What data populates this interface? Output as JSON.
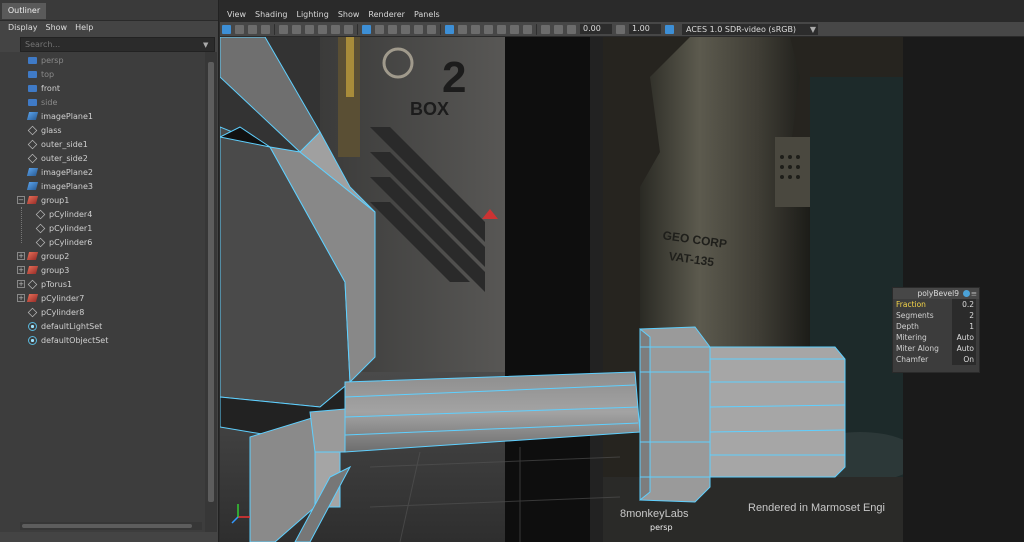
{
  "outliner": {
    "tab": "Outliner",
    "menu": [
      "Display",
      "Show",
      "Help"
    ],
    "search_placeholder": "Search...",
    "items": [
      {
        "label": "persp",
        "icon": "camera-icon",
        "indent": 1,
        "dim": true
      },
      {
        "label": "top",
        "icon": "camera-icon",
        "indent": 1,
        "dim": true
      },
      {
        "label": "front",
        "icon": "camera-icon",
        "indent": 1,
        "dim": false
      },
      {
        "label": "side",
        "icon": "camera-icon",
        "indent": 1,
        "dim": true
      },
      {
        "label": "imagePlane1",
        "icon": "image-plane-icon",
        "indent": 1,
        "dim": false
      },
      {
        "label": "glass",
        "icon": "mesh-icon",
        "indent": 1,
        "dim": false
      },
      {
        "label": "outer_side1",
        "icon": "mesh-icon",
        "indent": 1,
        "dim": false
      },
      {
        "label": "outer_side2",
        "icon": "mesh-icon",
        "indent": 1,
        "dim": false
      },
      {
        "label": "imagePlane2",
        "icon": "image-plane-icon",
        "indent": 1,
        "dim": false
      },
      {
        "label": "imagePlane3",
        "icon": "image-plane-icon",
        "indent": 1,
        "dim": false
      },
      {
        "label": "group1",
        "icon": "group-icon",
        "indent": 0,
        "expander": "−"
      },
      {
        "label": "pCylinder4",
        "icon": "mesh-icon",
        "indent": 2,
        "dim": false
      },
      {
        "label": "pCylinder1",
        "icon": "mesh-icon",
        "indent": 2,
        "dim": false
      },
      {
        "label": "pCylinder6",
        "icon": "mesh-icon",
        "indent": 2,
        "dim": false
      },
      {
        "label": "group2",
        "icon": "group-icon",
        "indent": 0,
        "expander": "+"
      },
      {
        "label": "group3",
        "icon": "group-icon",
        "indent": 0,
        "expander": "+"
      },
      {
        "label": "pTorus1",
        "icon": "mesh-icon",
        "indent": 0,
        "expander": "+"
      },
      {
        "label": "pCylinder7",
        "icon": "group-icon",
        "indent": 0,
        "expander": "+"
      },
      {
        "label": "pCylinder8",
        "icon": "mesh-icon",
        "indent": 1,
        "dim": false
      },
      {
        "label": "defaultLightSet",
        "icon": "set-icon",
        "indent": 1,
        "dim": false
      },
      {
        "label": "defaultObjectSet",
        "icon": "set-icon",
        "indent": 1,
        "dim": false
      }
    ]
  },
  "viewport": {
    "menu": [
      "View",
      "Shading",
      "Lighting",
      "Show",
      "Renderer",
      "Panels"
    ],
    "exposure": "0.00",
    "gamma": "1.00",
    "color_space": "ACES 1.0 SDR-video (sRGB)",
    "camera_label": "persp",
    "scene_text": {
      "box_label": "BOX",
      "box_number": "2",
      "stencil_1": "GEO CORP",
      "stencil_2": "VAT-135",
      "logo": "8monkeyLabs",
      "rendered_note": "Rendered in Marmoset Engi"
    }
  },
  "bevel_box": {
    "title": "polyBevel9",
    "rows": [
      {
        "label": "Fraction",
        "value": "0.2",
        "highlight": true
      },
      {
        "label": "Segments",
        "value": "2"
      },
      {
        "label": "Depth",
        "value": "1"
      },
      {
        "label": "Mitering",
        "value": "Auto"
      },
      {
        "label": "Miter Along",
        "value": "Auto"
      },
      {
        "label": "Chamfer",
        "value": "On"
      }
    ]
  },
  "colors": {
    "accent": "#3d8fd6",
    "wire": "#5fd0ff",
    "highlight": "#f5d548"
  }
}
